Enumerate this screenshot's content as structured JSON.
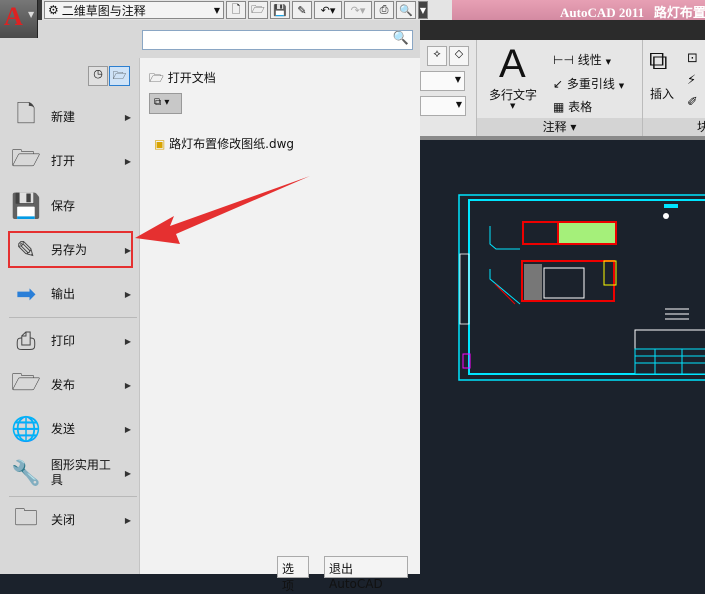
{
  "title_bar": {
    "app_title": "AutoCAD 2011",
    "document": "路灯布置"
  },
  "qat": {
    "workspace": "二维草图与注释",
    "buttons": [
      "new-icon",
      "open-icon",
      "save-icon",
      "saveas-icon",
      "undo-icon",
      "redo-icon",
      "plot-icon",
      "preview-icon"
    ]
  },
  "app_menu": {
    "search_placeholder": "",
    "items": [
      {
        "label": "新建",
        "submenu": true
      },
      {
        "label": "打开",
        "submenu": true
      },
      {
        "label": "保存",
        "submenu": false
      },
      {
        "label": "另存为",
        "submenu": true,
        "highlighted": true
      },
      {
        "label": "输出",
        "submenu": true
      },
      {
        "label": "打印",
        "submenu": true
      },
      {
        "label": "发布",
        "submenu": true
      },
      {
        "label": "发送",
        "submenu": true
      },
      {
        "label": "图形实用工具",
        "submenu": true
      },
      {
        "label": "关闭",
        "submenu": true
      }
    ],
    "recent_header": "打开文档",
    "recent_files": [
      "路灯布置修改图纸.dwg"
    ],
    "options_button": "选项",
    "exit_button": "退出 AutoCAD"
  },
  "ribbon": {
    "multiline_text": "多行文字",
    "linear": "线性",
    "multileader": "多重引线",
    "table": "表格",
    "annotation_panel": "注释",
    "insert": "插入",
    "block_panel": "块"
  },
  "colors": {
    "highlight": "#e53030",
    "arrow": "#e53030",
    "canvas": "#1b222c",
    "frame": "#00e5ff"
  }
}
